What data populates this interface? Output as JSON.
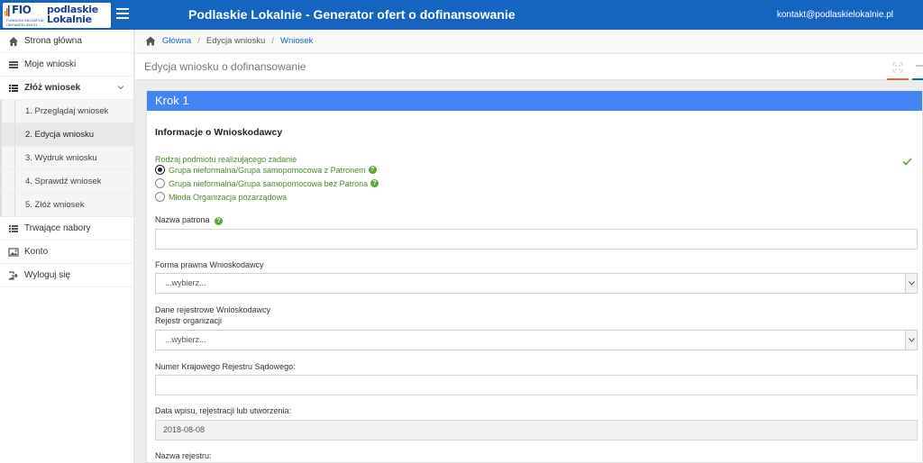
{
  "header": {
    "logo_fio": "FIO",
    "logo_fio_small": "FUNDUSZ INICJATYW OBYWATELSKICH",
    "logo_line1": "podlaskie",
    "logo_line2": "Lokalnie",
    "title": "Podlaskie Lokalnie - Generator ofert o dofinansowanie",
    "contact": "kontakt@podlaskielokalnie.pl",
    "brand_color": "#1565c0"
  },
  "sidebar": {
    "items": [
      {
        "label": "Strona główna",
        "icon": "home-icon"
      },
      {
        "label": "Moje wnioski",
        "icon": "list-icon"
      },
      {
        "label": "Złóż wniosek",
        "icon": "list-icon"
      }
    ],
    "sub_items": [
      {
        "label": "1. Przeglądaj wniosek"
      },
      {
        "label": "2. Edycja wniosku"
      },
      {
        "label": "3. Wydruk wniosku"
      },
      {
        "label": "4. Sprawdź wniosek"
      },
      {
        "label": "5. Złóż wniosek"
      }
    ],
    "bottom_items": [
      {
        "label": "Trwające nabory",
        "icon": "list-icon"
      },
      {
        "label": "Konto",
        "icon": "image-icon"
      },
      {
        "label": "Wyloguj się",
        "icon": "logout-icon"
      }
    ]
  },
  "breadcrumb": {
    "home": "Główna",
    "middle": "Edycja wniosku",
    "current": "Wniosek"
  },
  "page": {
    "title": "Edycja wniosku o dofinansowanie"
  },
  "form": {
    "step": "Krok 1",
    "section_title": "Informacje o Wnioskodawcy",
    "question": "Rodzaj podmiotu realizującego zadanie",
    "options": [
      {
        "label": "Grupa nieformalna/Grupa samopomocowa z Patronem",
        "checked": true,
        "help": true
      },
      {
        "label": "Grupa nieformalna/Grupa samopomocowa bez Patrona",
        "checked": false,
        "help": true
      },
      {
        "label": "Młoda Organizacja pozarządowa",
        "checked": false,
        "help": false
      }
    ],
    "help_glyph": "?",
    "patron_label": "Nazwa patrona",
    "patron_value": "",
    "legal_form_label": "Forma prawna Wnioskodawcy",
    "legal_form_value": "...wybierz...",
    "registry_data_label": "Dane rejestrowe Wnioskodawcy",
    "registry_label": "Rejestr organizacji",
    "registry_value": "...wybierz...",
    "krs_label": "Numer Krajowego Rejestru Sądowego:",
    "krs_value": "",
    "date_label": "Data wpisu, rejestracji lub utworzenia:",
    "date_value": "2018-08-08",
    "registry_name_label": "Nazwa rejestru:"
  }
}
